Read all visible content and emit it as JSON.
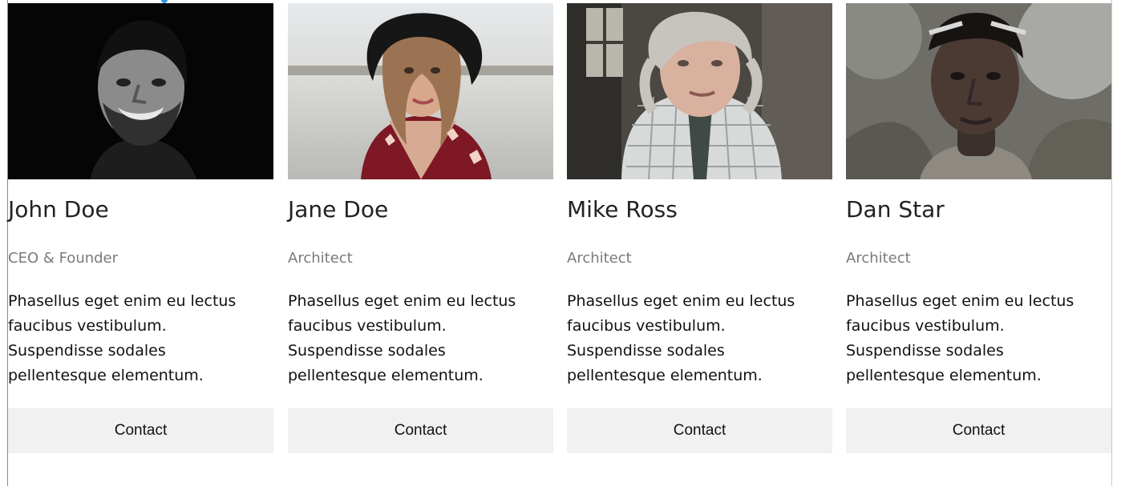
{
  "team": [
    {
      "name": "John Doe",
      "role": "CEO & Founder",
      "bio": "Phasellus eget enim eu lectus\nfaucibus vestibulum.\nSuspendisse sodales\npellentesque elementum.",
      "button": "Contact"
    },
    {
      "name": "Jane Doe",
      "role": "Architect",
      "bio": "Phasellus eget enim eu lectus\nfaucibus vestibulum.\nSuspendisse sodales\npellentesque elementum.",
      "button": "Contact"
    },
    {
      "name": "Mike Ross",
      "role": "Architect",
      "bio": "Phasellus eget enim eu lectus\nfaucibus vestibulum.\nSuspendisse sodales\npellentesque elementum.",
      "button": "Contact"
    },
    {
      "name": "Dan Star",
      "role": "Architect",
      "bio": "Phasellus eget enim eu lectus\nfaucibus vestibulum.\nSuspendisse sodales\npellentesque elementum.",
      "button": "Contact"
    }
  ],
  "colors": {
    "button_background": "#f1f1f1",
    "role_text": "#7a7a7a",
    "name_text": "#222222",
    "accent_fragment": "#2e98e8"
  }
}
